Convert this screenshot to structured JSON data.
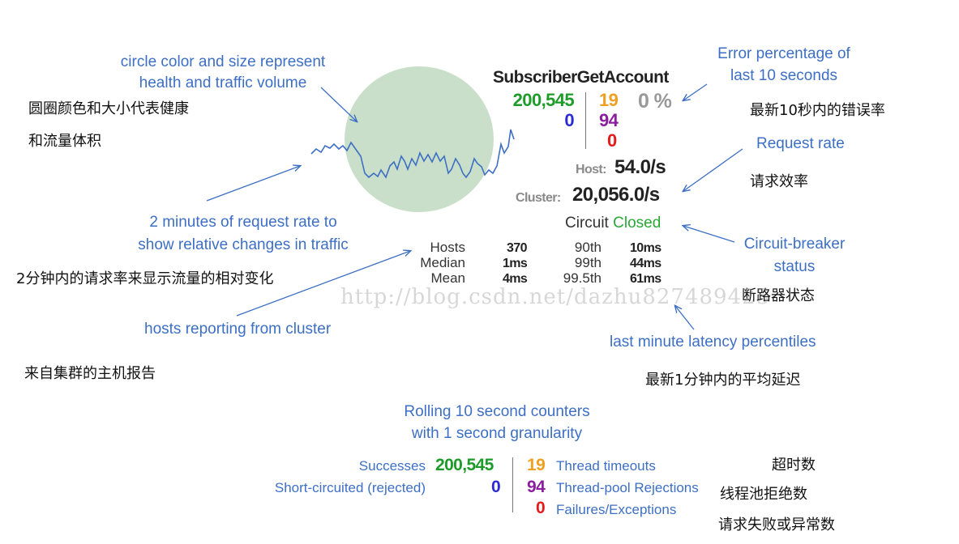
{
  "annotations": {
    "circle": "circle color and size represent\nhealth and traffic volume",
    "circle_cn_1": "圆圈颜色和大小代表健康",
    "circle_cn_2": "和流量体积",
    "error_pct": "Error percentage of\nlast 10 seconds",
    "error_pct_cn": "最新10秒内的错误率",
    "request_rate": "Request rate",
    "request_rate_cn": "请求效率",
    "sparkline": "2 minutes of request rate to\nshow relative changes in traffic",
    "sparkline_cn": "2分钟内的请求率来显示流量的相对变化",
    "circuit_breaker": "Circuit-breaker\nstatus",
    "circuit_breaker_cn": "断路器状态",
    "hosts_reporting": "hosts reporting from cluster",
    "hosts_reporting_cn": "来自集群的主机报告",
    "latency": "last minute latency percentiles",
    "latency_cn": "最新1分钟内的平均延迟",
    "rolling": "Rolling 10 second counters\nwith 1 second granularity",
    "timeouts_cn": "超时数",
    "rejections_cn": "线程池拒绝数",
    "failures_cn": "请求失败或异常数"
  },
  "panel": {
    "title": "SubscriberGetAccount",
    "successes": "200,545",
    "short_circuited": "0",
    "timeouts": "19",
    "rejections": "94",
    "failures": "0",
    "error_percent": "0 %",
    "host_label": "Host:",
    "host_rate": "54.0/s",
    "cluster_label": "Cluster:",
    "cluster_rate": "20,056.0/s",
    "circuit_label": "Circuit",
    "circuit_status": "Closed"
  },
  "stats": {
    "hosts_label": "Hosts",
    "hosts_value": "370",
    "median_label": "Median",
    "median_value": "1ms",
    "mean_label": "Mean",
    "mean_value": "4ms",
    "p90_label": "90th",
    "p90_value": "10ms",
    "p99_label": "99th",
    "p99_value": "44ms",
    "p995_label": "99.5th",
    "p995_value": "61ms"
  },
  "legend": {
    "successes_label": "Successes",
    "successes_value": "200,545",
    "short_circuited_label": "Short-circuited (rejected)",
    "short_circuited_value": "0",
    "timeouts_value": "19",
    "timeouts_label": "Thread timeouts",
    "rejections_value": "94",
    "rejections_label": "Thread-pool Rejections",
    "failures_value": "0",
    "failures_label": "Failures/Exceptions"
  },
  "watermark": "http://blog.csdn.net/dazhu827489425",
  "colors": {
    "success": "#1e9c2a",
    "short_circuited": "#2b2bd4",
    "timeout": "#f0a020",
    "rejection": "#8a1f9e",
    "failure": "#e51a1a",
    "error_pct": "#999999",
    "annotation": "#3d6fc4",
    "circle_fill": "#c9dfc9"
  },
  "icons": [
    "annotation-arrow",
    "health-circle",
    "request-rate-sparkline"
  ]
}
